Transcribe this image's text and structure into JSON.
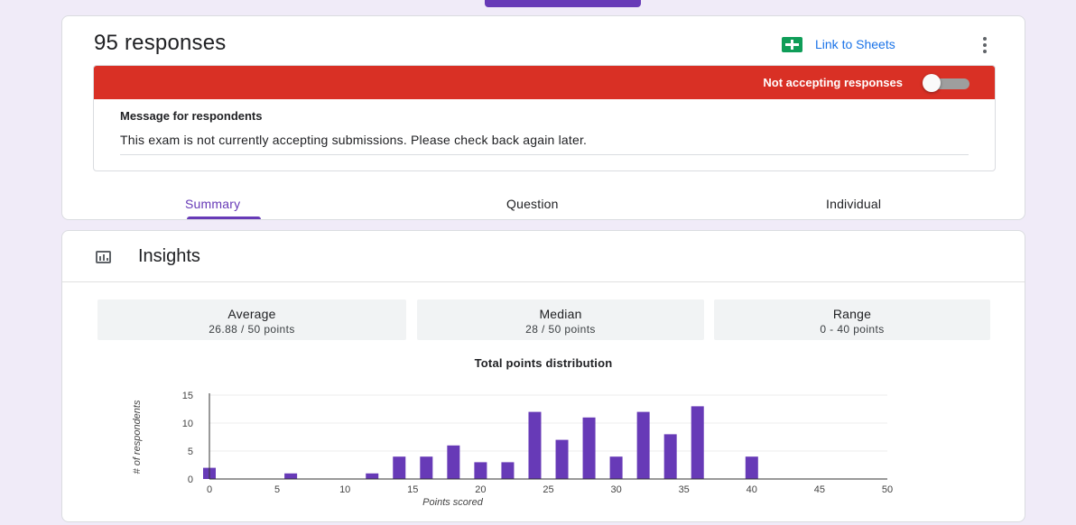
{
  "header": {
    "responses_title": "95 responses",
    "sheets_link": "Link to Sheets",
    "sheets_icon": "sheets-icon",
    "more_icon": "more-vert-icon"
  },
  "status": {
    "accepting_text": "Not accepting responses",
    "accepting": false,
    "banner_color": "#d93025",
    "message_heading": "Message for respondents",
    "message_body": "This exam is not currently accepting submissions. Please check back again later."
  },
  "tabs": [
    {
      "label": "Summary",
      "active": true
    },
    {
      "label": "Question",
      "active": false
    },
    {
      "label": "Individual",
      "active": false
    }
  ],
  "insights": {
    "title": "Insights",
    "icon": "insights-icon",
    "stats": [
      {
        "label": "Average",
        "value": "26.88 / 50 points"
      },
      {
        "label": "Median",
        "value": "28 / 50 points"
      },
      {
        "label": "Range",
        "value": "0 - 40 points"
      }
    ]
  },
  "chart_data": {
    "type": "bar",
    "title": "Total points distribution",
    "xlabel": "Points scored",
    "ylabel": "# of respondents",
    "xlim": [
      0,
      50
    ],
    "ylim": [
      0,
      15
    ],
    "xticks": [
      0,
      5,
      10,
      15,
      20,
      25,
      30,
      35,
      40,
      45,
      50
    ],
    "yticks": [
      0,
      5,
      10,
      15
    ],
    "grid": true,
    "color": "#673ab7",
    "x": [
      0,
      6,
      12,
      14,
      16,
      18,
      20,
      22,
      24,
      26,
      28,
      30,
      32,
      34,
      36,
      40
    ],
    "values": [
      2,
      1,
      1,
      4,
      4,
      6,
      3,
      3,
      12,
      7,
      11,
      4,
      12,
      8,
      13,
      4
    ]
  },
  "colors": {
    "accent": "#673ab7",
    "background": "#f0ebf8",
    "link": "#1a73e8"
  }
}
